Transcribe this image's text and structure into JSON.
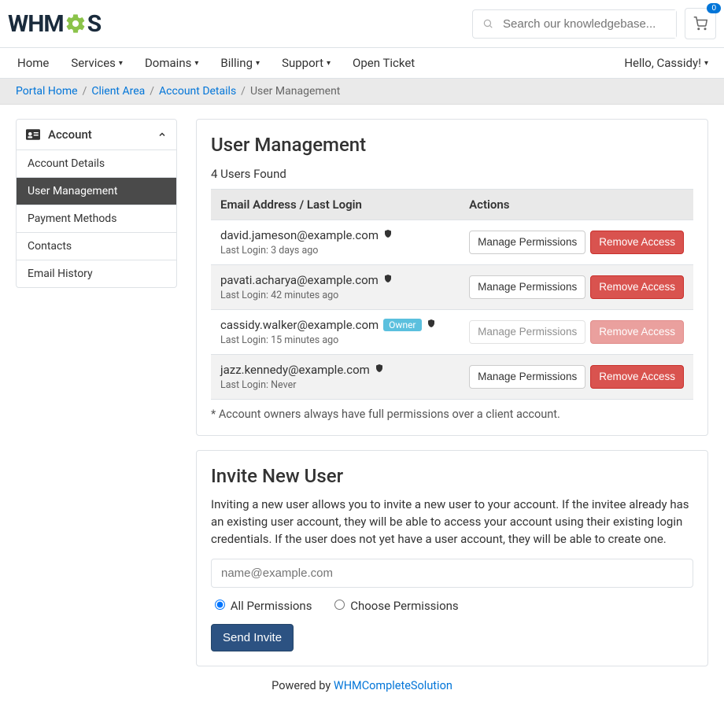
{
  "logo_text_left": "WHM",
  "logo_text_right": "S",
  "search": {
    "placeholder": "Search our knowledgebase..."
  },
  "cart_count": "0",
  "nav": {
    "items": [
      {
        "label": "Home",
        "caret": false
      },
      {
        "label": "Services",
        "caret": true
      },
      {
        "label": "Domains",
        "caret": true
      },
      {
        "label": "Billing",
        "caret": true
      },
      {
        "label": "Support",
        "caret": true
      },
      {
        "label": "Open Ticket",
        "caret": false
      }
    ],
    "user_greeting": "Hello, Cassidy!"
  },
  "breadcrumb": [
    {
      "label": "Portal Home",
      "link": true
    },
    {
      "label": "Client Area",
      "link": true
    },
    {
      "label": "Account Details",
      "link": true
    },
    {
      "label": "User Management",
      "link": false
    }
  ],
  "sidebar": {
    "title": "Account",
    "items": [
      {
        "label": "Account Details",
        "active": false
      },
      {
        "label": "User Management",
        "active": true
      },
      {
        "label": "Payment Methods",
        "active": false
      },
      {
        "label": "Contacts",
        "active": false
      },
      {
        "label": "Email History",
        "active": false
      }
    ]
  },
  "userMgmt": {
    "heading": "User Management",
    "countText": "4 Users Found",
    "th_email": "Email Address / Last Login",
    "th_actions": "Actions",
    "rows": [
      {
        "email": "david.jameson@example.com",
        "owner": false,
        "shield": true,
        "last_login": "Last Login: 3 days ago",
        "disabled": false
      },
      {
        "email": "pavati.acharya@example.com",
        "owner": false,
        "shield": true,
        "last_login": "Last Login: 42 minutes ago",
        "disabled": false
      },
      {
        "email": "cassidy.walker@example.com",
        "owner": true,
        "shield": true,
        "last_login": "Last Login: 15 minutes ago",
        "disabled": true
      },
      {
        "email": "jazz.kennedy@example.com",
        "owner": false,
        "shield": true,
        "last_login": "Last Login: Never",
        "disabled": false
      }
    ],
    "owner_label": "Owner",
    "manage_label": "Manage Permissions",
    "remove_label": "Remove Access",
    "footnote": "* Account owners always have full permissions over a client account."
  },
  "invite": {
    "heading": "Invite New User",
    "blurb": "Inviting a new user allows you to invite a new user to your account. If the invitee already has an existing user account, they will be able to access your account using their existing login credentials. If the user does not yet have a user account, they will be able to create one.",
    "placeholder": "name@example.com",
    "radio_all": "All Permissions",
    "radio_choose": "Choose Permissions",
    "submit": "Send Invite"
  },
  "footer": {
    "label": "Powered by ",
    "link": "WHMCompleteSolution"
  }
}
